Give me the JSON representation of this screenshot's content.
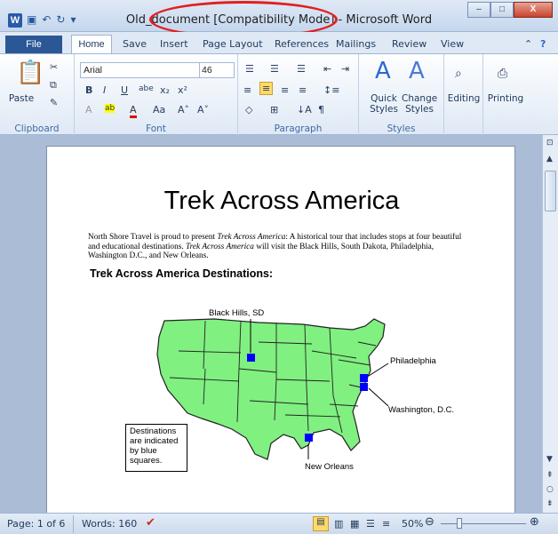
{
  "window": {
    "title": "Old_document [Compatibility Mode] - Microsoft Word",
    "app_icon": "W",
    "minimize": "–",
    "maximize": "□",
    "close": "X"
  },
  "tabs": [
    "File",
    "Home",
    "Save",
    "Insert",
    "Page Layout",
    "References",
    "Mailings",
    "Review",
    "View"
  ],
  "ribbon": {
    "clipboard": {
      "paste": "Paste",
      "label": "Clipboard"
    },
    "font": {
      "name": "Arial",
      "size": "46",
      "label": "Font"
    },
    "paragraph": {
      "label": "Paragraph"
    },
    "styles": {
      "quick": "Quick Styles",
      "change": "Change Styles",
      "label": "Styles"
    },
    "editing": "Editing",
    "printing": "Printing"
  },
  "document": {
    "title": "Trek Across America",
    "paragraph_1": "North Shore Travel is proud to present ",
    "italic_1": "Trek Across America",
    "paragraph_2": ": A historical tour that includes stops at four beautiful and educational destinations. ",
    "italic_2": "Trek Across America",
    "paragraph_3": " will visit the Black Hills, South Dakota, Philadelphia, Washington D.C., and New Orleans.",
    "heading": "Trek Across America Destinations:",
    "map_labels": {
      "black_hills": "Black Hills, SD",
      "philadelphia": "Philadelphia",
      "washington": "Washington, D.C.",
      "new_orleans": "New Orleans"
    },
    "note": "Destinations are indicated by blue squares."
  },
  "status": {
    "page": "Page: 1 of 6",
    "words": "Words: 160",
    "zoom": "50%"
  },
  "colors": {
    "map_fill": "#80f080",
    "marker": "#0000ff",
    "highlight_oval": "#e02020"
  }
}
